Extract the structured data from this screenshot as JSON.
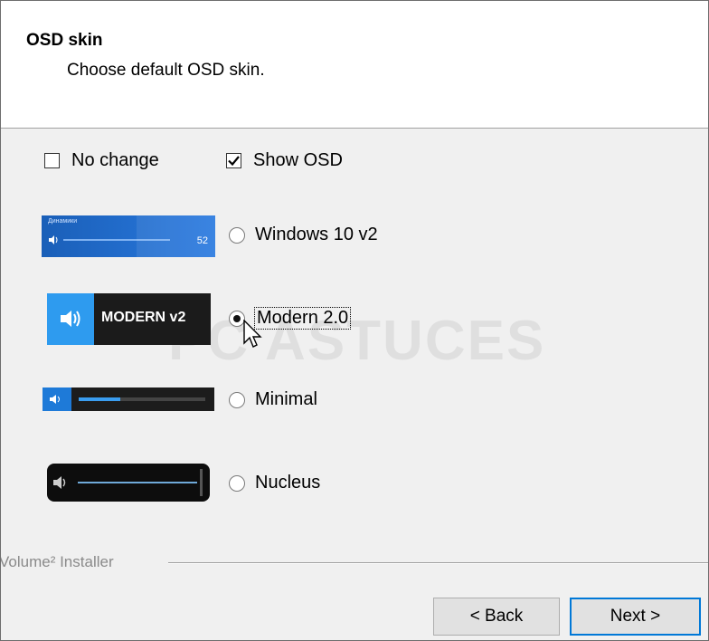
{
  "header": {
    "title": "OSD skin",
    "subtitle": "Choose default OSD skin."
  },
  "options": {
    "no_change": {
      "label": "No change",
      "checked": false
    },
    "show_osd": {
      "label": "Show OSD",
      "checked": true
    }
  },
  "skins": [
    {
      "label": "Windows 10 v2",
      "selected": false,
      "preview": {
        "device": "Динамики",
        "value": "52",
        "accent": "#1e6fd0"
      }
    },
    {
      "label": "Modern 2.0",
      "selected": true,
      "preview": {
        "text": "MODERN v2",
        "accent": "#2e9bef"
      }
    },
    {
      "label": "Minimal",
      "selected": false,
      "preview": {
        "accent": "#1e7ad8"
      }
    },
    {
      "label": "Nucleus",
      "selected": false
    }
  ],
  "watermark": "PC ASTUCES",
  "group_label": "Volume² Installer",
  "buttons": {
    "back": "< Back",
    "next": "Next >"
  }
}
